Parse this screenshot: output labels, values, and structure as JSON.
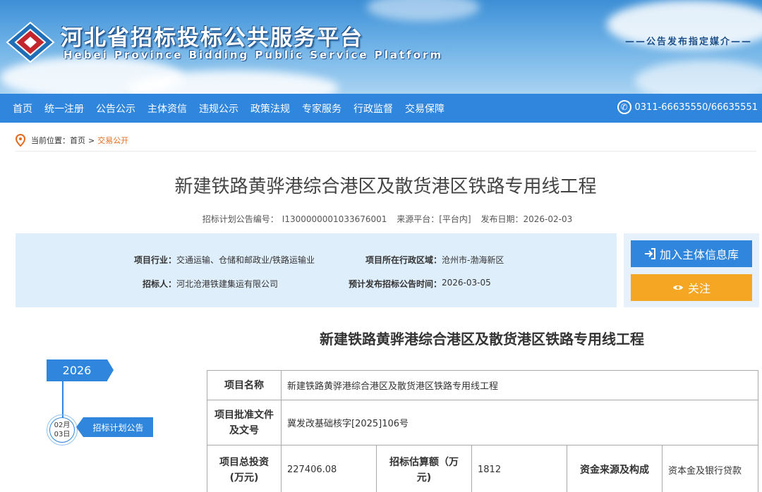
{
  "header": {
    "title": "河北省招标投标公共服务平台",
    "subtitle": "Hebei Province Bidding Public Service Platform",
    "media_tag": "——公告发布指定媒介——"
  },
  "nav": {
    "items": [
      "首页",
      "统一注册",
      "公告公示",
      "主体资信",
      "违规公示",
      "政策法规",
      "专家服务",
      "行政监督",
      "交易保障"
    ],
    "phone": "0311-66635550/66635551"
  },
  "breadcrumb": {
    "prefix": "当前位置：",
    "home": "首页",
    "sep": ">",
    "current": "交易公开"
  },
  "project": {
    "title": "新建铁路黄骅港综合港区及散货港区铁路专用线工程",
    "meta": {
      "code_label": "招标计划公告编号：",
      "code": "I1300000001033676001",
      "source_label": "来源平台：",
      "source": "[平台内]",
      "date_label": "发布日期：",
      "date": "2026-02-03"
    },
    "info": {
      "industry_label": "项目行业：",
      "industry": "交通运输、仓储和邮政业/铁路运输业",
      "region_label": "项目所在行政区域：",
      "region": "沧州市-渤海新区",
      "tenderer_label": "招标人：",
      "tenderer": "河北沧港铁建集运有限公司",
      "planned_label": "预计发布招标公告时间：",
      "planned": "2026-03-05"
    }
  },
  "actions": {
    "add_label": "加入主体信息库",
    "follow_label": "关注"
  },
  "timeline": {
    "year": "2026",
    "month": "02月",
    "day": "03日",
    "event": "招标计划公告"
  },
  "detail": {
    "title": "新建铁路黄骅港综合港区及散货港区铁路专用线工程",
    "rows": {
      "name_label": "项目名称",
      "name": "新建铁路黄骅港综合港区及散货港区铁路专用线工程",
      "approval_label_1": "项目批准文件",
      "approval_label_2": "及文号",
      "approval": "冀发改基础核字[2025]106号",
      "invest_label_1": "项目总投资",
      "invest_label_2": "(万元)",
      "invest": "227406.08",
      "estimate_label_1": "招标估算额（万",
      "estimate_label_2": "元)",
      "estimate": "1812",
      "fund_label": "资金来源及构成",
      "fund": "资本金及银行贷款"
    }
  },
  "colors": {
    "nav_bg": "#2f86dc",
    "accent_orange": "#f5a623",
    "breadcrumb_current": "#e5691b"
  }
}
